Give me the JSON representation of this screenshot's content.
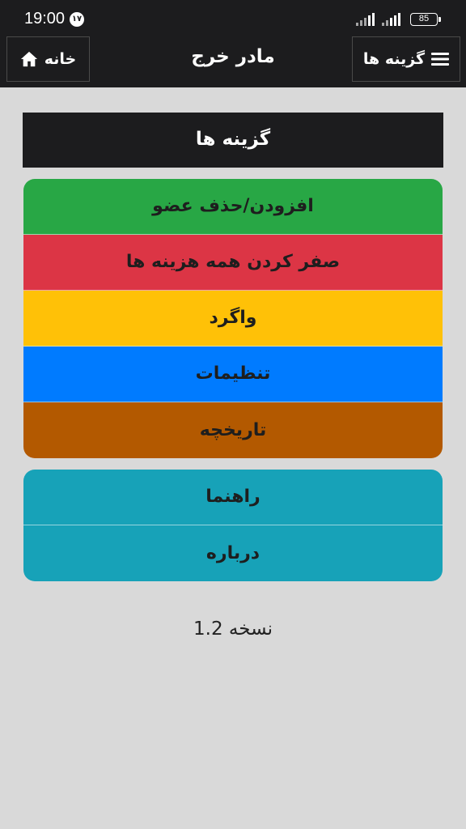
{
  "status_bar": {
    "time": "19:00",
    "notification_badge": "۱۷",
    "battery": "85"
  },
  "header": {
    "home_label": "خانه",
    "home_icon": "home-icon",
    "title": "مادر خرج",
    "options_label": "گزینه ها",
    "options_icon": "hamburger-menu-icon"
  },
  "panel": {
    "title": "گزینه ها"
  },
  "menu": {
    "primary": [
      {
        "label": "افزودن/حذف عضو",
        "color": "#28a745"
      },
      {
        "label": "صفر کردن همه هزینه ها",
        "color": "#dc3545"
      },
      {
        "label": "واگرد",
        "color": "#ffc107"
      },
      {
        "label": "تنظیمات",
        "color": "#007bff"
      },
      {
        "label": "تاریخچه",
        "color": "#b35900"
      }
    ],
    "secondary": [
      {
        "label": "راهنما",
        "color": "#17a2b8"
      },
      {
        "label": "درباره",
        "color": "#17a2b8"
      }
    ]
  },
  "footer": {
    "version": "نسخه 1.2"
  }
}
